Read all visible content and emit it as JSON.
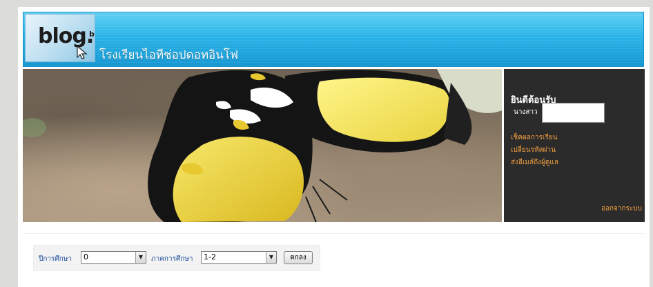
{
  "header": {
    "logo_text": "blog...",
    "logo_text_small": "blo",
    "site_title": "โรงเรียนไอทีช่อปดอทอินโฟ"
  },
  "sidebar": {
    "welcome": "ยินดีต้อนรับ",
    "name_prefix": "นางสาว",
    "name_value": "",
    "links": [
      {
        "label": "เช็คผลการเรียน"
      },
      {
        "label": "เปลี่ยนรหัสผ่าน"
      },
      {
        "label": "ส่งอีเมล์ถึงผู้ดูแล"
      }
    ],
    "logout": "ออกจากระบบ"
  },
  "filters": {
    "year_label": "ปีการศึกษา",
    "year_value": "0",
    "term_label": "ภาคการศึกษา",
    "term_value": "1-2",
    "submit_label": "ตกลง"
  },
  "colors": {
    "banner": "#29b4e8",
    "sidebar_bg": "#2b2b2b",
    "link": "#f5a040",
    "label": "#1f4e9c"
  },
  "icons": {
    "logo": "blog-logo-icon",
    "cursor": "mouse-cursor-icon",
    "dropdown": "chevron-down-icon"
  }
}
